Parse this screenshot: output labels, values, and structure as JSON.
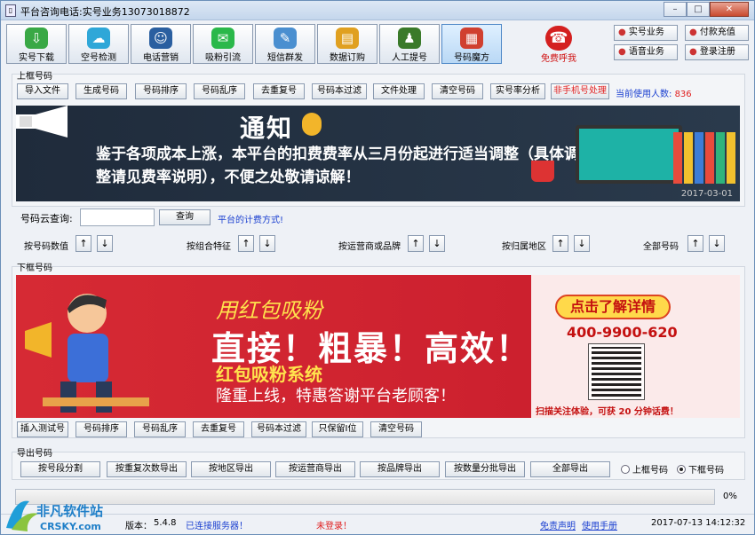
{
  "window": {
    "title": "平台咨询电话:实号业务13073018872"
  },
  "window_buttons": [
    "–",
    "□",
    "✕"
  ],
  "toolbar": [
    {
      "label": "实号下载",
      "icon": "download-icon",
      "color": "#39a845"
    },
    {
      "label": "空号检测",
      "icon": "cloud-check-icon",
      "color": "#2fa7d8"
    },
    {
      "label": "电话营销",
      "icon": "people-icon",
      "color": "#2a5fa0"
    },
    {
      "label": "吸粉引流",
      "icon": "wechat-icon",
      "color": "#2ab84a"
    },
    {
      "label": "短信群发",
      "icon": "message-icon",
      "color": "#4a8fd0"
    },
    {
      "label": "数据订购",
      "icon": "document-chart-icon",
      "color": "#e0a020"
    },
    {
      "label": "人工提号",
      "icon": "agent-icon",
      "color": "#3a7a2a"
    },
    {
      "label": "号码魔方",
      "icon": "rubik-cube-icon",
      "color": "#d04030"
    }
  ],
  "free_call": {
    "label": "免费呼我",
    "icon": "phone-icon"
  },
  "side_buttons": [
    {
      "label": "实号业务",
      "icon": "user-icon"
    },
    {
      "label": "付款充值",
      "icon": "payment-icon"
    },
    {
      "label": "语音业务",
      "icon": "voice-icon"
    },
    {
      "label": "登录注册",
      "icon": "login-icon"
    }
  ],
  "upper": {
    "group_label": "上框号码",
    "buttons": [
      "导入文件",
      "生成号码",
      "号码排序",
      "号码乱序",
      "去重复号",
      "号码本过滤",
      "文件处理",
      "清空号码",
      "实号率分析",
      "非手机号处理"
    ],
    "users_label": "当前使用人数:",
    "users_count": "836"
  },
  "notice": {
    "title": "通知",
    "text": "鉴于各项成本上涨，本平台的扣费费率从三月份起进行适当调整（具体调整请见费率说明），不便之处敬请谅解！",
    "date": "2017-03-01"
  },
  "cloud_search": {
    "label": "号码云查询:",
    "value": "",
    "button": "查询",
    "link": "平台的计费方式!"
  },
  "sort_by": [
    {
      "label": "按号码数值"
    },
    {
      "label": "按组合特征"
    },
    {
      "label": "按运营商或品牌"
    },
    {
      "label": "按归属地区"
    },
    {
      "label": "全部号码"
    }
  ],
  "arrows": {
    "up": "↑",
    "down": "↓"
  },
  "lower": {
    "group_label": "下框号码",
    "buttons": [
      "插入测试号",
      "号码排序",
      "号码乱序",
      "去重复号",
      "号码本过滤",
      "只保留I位",
      "清空号码"
    ]
  },
  "promo": {
    "subtitle": "用红包吸粉",
    "headline": "直接！粗暴！高效！",
    "system": "红包吸粉系统",
    "slogan": "隆重上线，特惠答谢平台老顾客！",
    "cta": "点击了解详情",
    "tel": "400-9900-620",
    "footer": "扫描关注体验，可获 20 分钟话费！"
  },
  "export": {
    "group_label": "导出号码",
    "buttons": [
      "按号段分割",
      "按重复次数导出",
      "按地区导出",
      "按运营商导出",
      "按品牌导出",
      "按数量分批导出",
      "全部导出"
    ],
    "radio_upper": "上框号码",
    "radio_lower": "下框号码",
    "selected": "下框号码"
  },
  "progress": {
    "value": 0,
    "label": "0%"
  },
  "status": {
    "version_label": "版本：",
    "version": "5.4.8",
    "server": "已连接服务器！",
    "login": "未登录！",
    "disclaimer": "免责声明",
    "manual": "使用手册",
    "datetime": "2017-07-13 14:12:32"
  },
  "watermark": {
    "name": "非凡软件站",
    "domain": "CRSKY.com"
  },
  "colors": {
    "accent_red": "#e02020",
    "link_blue": "#1a3fd0",
    "banner_red": "#d62a34",
    "notice_bg": "#1f2b3b"
  }
}
